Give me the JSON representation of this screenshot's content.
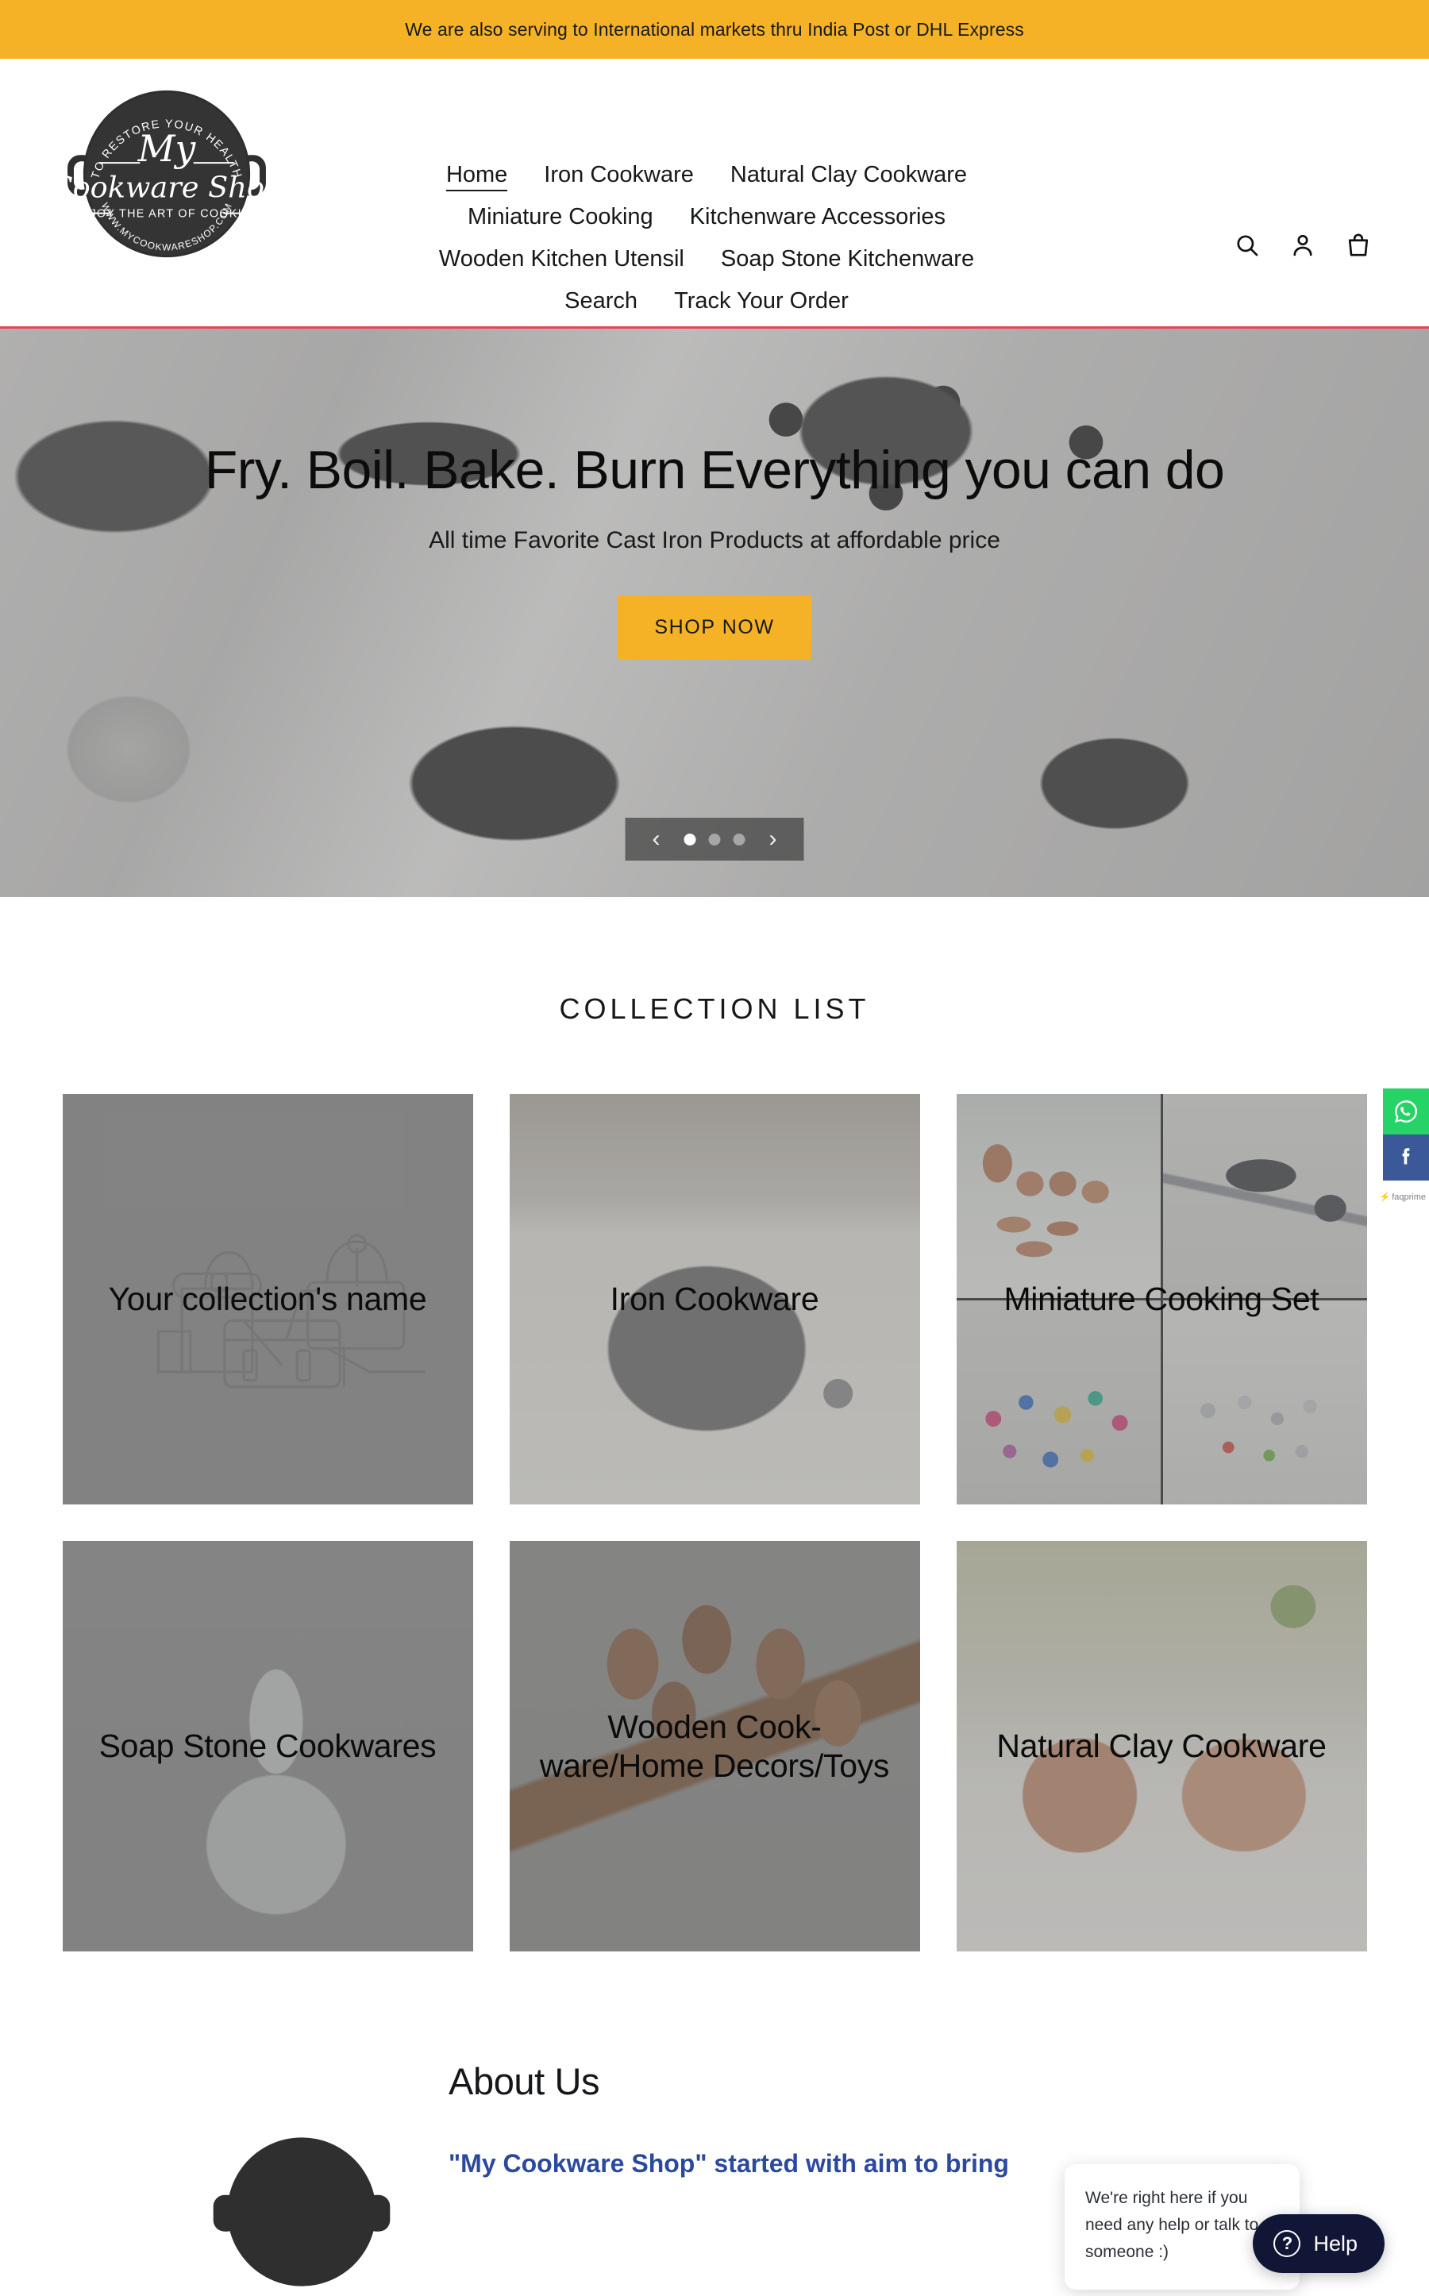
{
  "announcement": {
    "text": "We are also serving to International markets thru India Post or DHL Express",
    "bg_color": "#f5b227"
  },
  "header": {
    "logo": {
      "tagline_top": "TO RESTORE YOUR HEALTH",
      "name_line1": "My",
      "name_line2": "Cookware Shop",
      "tagline_mid": "ENJOY THE ART OF COOKING",
      "url_text": "WWW.MYCOOKWARESHOP.COM"
    },
    "nav_rows": [
      [
        {
          "label": "Home",
          "active": true
        },
        {
          "label": "Iron Cookware",
          "active": false
        },
        {
          "label": "Natural Clay Cookware",
          "active": false
        }
      ],
      [
        {
          "label": "Miniature Cooking",
          "active": false
        },
        {
          "label": "Kitchenware Accessories",
          "active": false
        }
      ],
      [
        {
          "label": "Wooden Kitchen Utensil",
          "active": false
        },
        {
          "label": "Soap Stone Kitchenware",
          "active": false
        }
      ],
      [
        {
          "label": "Search",
          "active": false
        },
        {
          "label": "Track Your Order",
          "active": false
        }
      ]
    ],
    "icons": [
      {
        "name": "search-icon"
      },
      {
        "name": "account-icon"
      },
      {
        "name": "cart-icon"
      }
    ],
    "divider_color": "#e8445a"
  },
  "hero": {
    "title": "Fry. Boil. Bake. Burn Everything you can do",
    "subtitle": "All time Favorite Cast Iron Products at affordable price",
    "button_label": "SHOP NOW",
    "button_color": "#f5b227",
    "carousel": {
      "prev_label": "‹",
      "next_label": "›",
      "slide_count": 3,
      "active_slide": 1
    }
  },
  "collections": {
    "section_title": "COLLECTION LIST",
    "cards": [
      {
        "label": "Your collection's name",
        "art": "placeholder"
      },
      {
        "label": "Iron Cookware",
        "art": "iron"
      },
      {
        "label": "Miniature Cooking Set",
        "art": "miniature"
      },
      {
        "label": "Soap Stone Cookwares",
        "art": "soapstone"
      },
      {
        "label": "Wooden Cook-ware/Home Decors/Toys",
        "art": "wooden"
      },
      {
        "label": "Natural Clay Cookware",
        "art": "clay"
      }
    ]
  },
  "about": {
    "title": "About Us",
    "body": "\"My Cookware Shop\" started with aim to bring",
    "body_color": "#2b4a9e"
  },
  "widgets": {
    "social": [
      {
        "name": "whatsapp-icon",
        "color": "#25d366"
      },
      {
        "name": "facebook-icon",
        "color": "#3b5998"
      }
    ],
    "credit": "faqprime",
    "chat_message": "We're right here if you need any help or talk to someone :)",
    "help_label": "Help",
    "help_color": "#111636"
  }
}
